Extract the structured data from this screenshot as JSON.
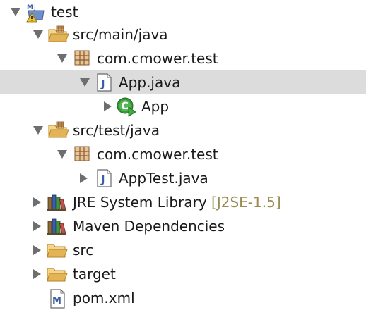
{
  "tree": {
    "project": {
      "label": "test",
      "icon": "maven-project-warning-icon",
      "expanded": true
    },
    "src_main_java": {
      "label": "src/main/java",
      "icon": "source-folder-icon",
      "expanded": true
    },
    "pkg_main": {
      "label": "com.cmower.test",
      "icon": "package-icon",
      "expanded": true
    },
    "app_java": {
      "label": "App.java",
      "icon": "java-file-icon",
      "expanded": true,
      "selected": true
    },
    "app_class": {
      "label": "App",
      "icon": "runnable-class-icon",
      "expanded": false
    },
    "src_test_java": {
      "label": "src/test/java",
      "icon": "source-folder-icon",
      "expanded": true
    },
    "pkg_test": {
      "label": "com.cmower.test",
      "icon": "package-icon",
      "expanded": true
    },
    "apptest_java": {
      "label": "AppTest.java",
      "icon": "java-file-icon",
      "expanded": false
    },
    "jre": {
      "label": "JRE System Library",
      "decoration": "[J2SE-1.5]",
      "icon": "library-icon",
      "expanded": false
    },
    "maven_deps": {
      "label": "Maven Dependencies",
      "icon": "library-icon",
      "expanded": false
    },
    "src": {
      "label": "src",
      "icon": "folder-icon",
      "expanded": false
    },
    "target": {
      "label": "target",
      "icon": "folder-icon",
      "expanded": false
    },
    "pom": {
      "label": "pom.xml",
      "icon": "maven-pom-icon"
    }
  },
  "colors": {
    "selection": "#dcdcdc",
    "twisty": "#6e6e6e",
    "decoration": "#9b8a4e",
    "java_blue": "#3b5fa0",
    "class_green": "#3a9a3a",
    "folder": "#e3b356"
  }
}
